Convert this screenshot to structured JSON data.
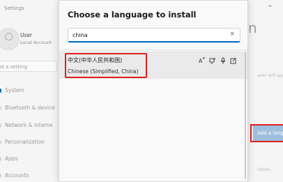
{
  "background": {
    "app_title": "Settings",
    "user_name": "User",
    "user_account": "Local Account",
    "find_setting": "nd a setting",
    "nav": [
      "System",
      "Bluetooth & device",
      "Network & interne",
      "Personalization",
      "Apps",
      "Accounts"
    ],
    "page_title_fragment": "n",
    "note_fragment": "arer will appear",
    "add_button": "Add a lang",
    "note_fragment2": "nition."
  },
  "dialog": {
    "title": "Choose a language to install",
    "search": {
      "value": "china",
      "clear_icon": "×"
    },
    "results": [
      {
        "native_name": "中文(中华人民共和国)",
        "english_name": "Chinese (Simplified, China)",
        "feature_icons": [
          "text-to-speech-icon",
          "display-language-icon",
          "speech-recognition-icon",
          "handwriting-icon"
        ]
      }
    ]
  },
  "colors": {
    "accent": "#0067c0",
    "highlight": "#e02020",
    "add_button_bg": "#9fbfde"
  }
}
